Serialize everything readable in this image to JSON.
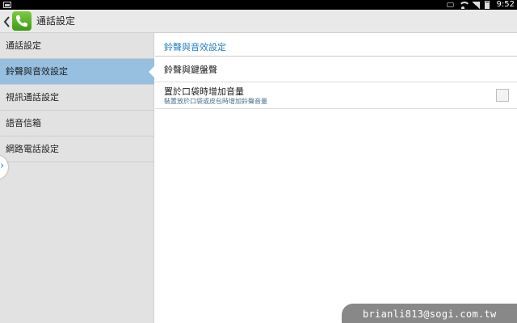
{
  "status_bar": {
    "time": "9:52",
    "icons": [
      "gallery-notification-icon",
      "vibrate-icon",
      "wifi-icon",
      "signal-icon",
      "battery-icon"
    ]
  },
  "action_bar": {
    "title": "通話設定",
    "app_icon": "phone-icon",
    "back_icon": "chevron-left-icon"
  },
  "sidebar": {
    "items": [
      {
        "label": "通話設定",
        "selected": false
      },
      {
        "label": "鈴聲與音效設定",
        "selected": true
      },
      {
        "label": "視訊通話設定",
        "selected": false
      },
      {
        "label": "語音信箱",
        "selected": false
      },
      {
        "label": "網路電話設定",
        "selected": false
      }
    ],
    "handle_icon": "chevron-right-icon"
  },
  "content": {
    "section_title": "鈴聲與音效設定",
    "rows": [
      {
        "title": "鈴聲與鍵盤聲"
      },
      {
        "title": "置於口袋時增加音量",
        "subtitle": "裝置放於口袋或皮包時增加鈴聲音量",
        "checked": false
      }
    ]
  },
  "watermark": {
    "text": "brianli813@sogi.com.tw"
  },
  "colors": {
    "accent": "#2381c4",
    "selected_item": "#96bfe0",
    "sidebar_bg": "#e2e2e2",
    "app_icon_green": "#4caf27"
  }
}
